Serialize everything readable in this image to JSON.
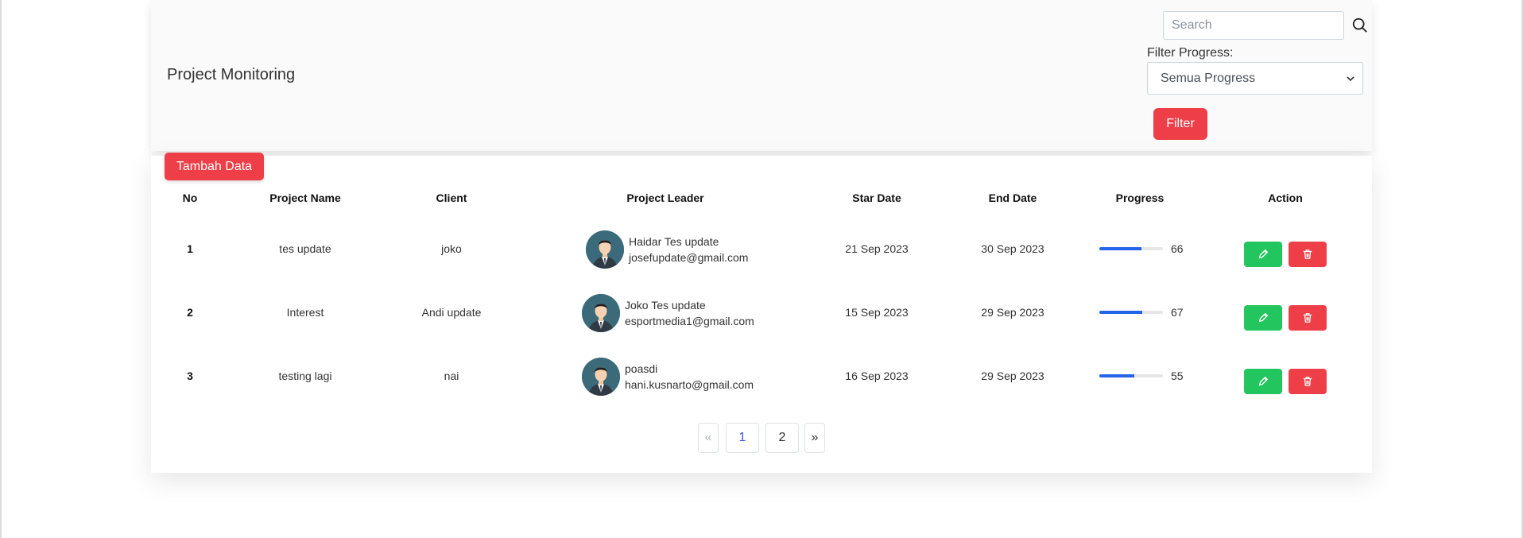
{
  "header": {
    "title": "Project Monitoring",
    "search_placeholder": "Search",
    "filter_label": "Filter Progress:",
    "filter_selected": "Semua Progress",
    "filter_button": "Filter"
  },
  "table": {
    "add_button": "Tambah Data",
    "columns": [
      "No",
      "Project Name",
      "Client",
      "Project Leader",
      "Star Date",
      "End Date",
      "Progress",
      "Action"
    ],
    "rows": [
      {
        "no": "1",
        "project": "tes update",
        "client": "joko",
        "leader_name": "Haidar Tes update",
        "leader_email": "josefupdate@gmail.com",
        "start": "21 Sep 2023",
        "end": "30 Sep 2023",
        "progress": 66
      },
      {
        "no": "2",
        "project": "Interest",
        "client": "Andi update",
        "leader_name": "Joko Tes update",
        "leader_email": "esportmedia1@gmail.com",
        "start": "15 Sep 2023",
        "end": "29 Sep 2023",
        "progress": 67
      },
      {
        "no": "3",
        "project": "testing lagi",
        "client": "nai",
        "leader_name": "poasdi",
        "leader_email": "hani.kusnarto@gmail.com",
        "start": "16 Sep 2023",
        "end": "29 Sep 2023",
        "progress": 55
      }
    ]
  },
  "pagination": {
    "prev": "«",
    "pages": [
      "1",
      "2"
    ],
    "next": "»",
    "active_page": "1"
  },
  "colors": {
    "danger": "#ee3f48",
    "success": "#22c55e",
    "progress": "#2563eb",
    "link": "#3b5bdb"
  }
}
